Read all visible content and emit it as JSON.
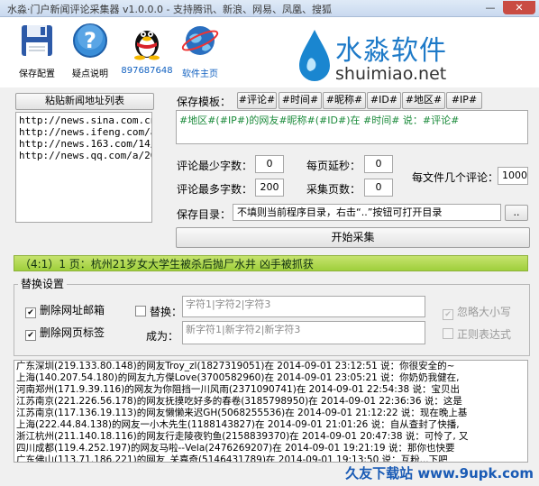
{
  "window": {
    "title": "水淼·门户新闻评论采集器 v1.0.0.0 - 支持腾讯、新浪、网易、凤凰、搜狐",
    "minimize": "—",
    "close": "✕"
  },
  "toolbar": {
    "save_config": "保存配置",
    "help": "疑点说明",
    "qq": "897687648",
    "homepage": "软件主页"
  },
  "logo": {
    "name": "水淼软件",
    "site": "shuimiao.net"
  },
  "url_list": {
    "button": "粘贴新闻地址列表",
    "lines": [
      "http://news.sina.com.cn/",
      "http://news.ifeng.com/a/",
      "http://news.163.com/14/0",
      "http://news.qq.com/a/201"
    ]
  },
  "template": {
    "label": "保存模板：",
    "tags": [
      "#评论#",
      "#时间#",
      "#昵称#",
      "#ID#",
      "#地区#",
      "#IP#"
    ],
    "value": "#地区#(#IP#)的网友#昵称#(#ID#)在 #时间# 说：#评论#"
  },
  "settings": {
    "min_chars_label": "评论最少字数：",
    "min_chars": "0",
    "max_chars_label": "评论最多字数：",
    "max_chars": "200",
    "delay_label": "每页延秒：",
    "delay": "0",
    "pages_label": "采集页数：",
    "pages": "0",
    "per_file_label": "每文件几个评论：",
    "per_file": "1000",
    "save_dir_label": "保存目录：",
    "save_dir_value": "不填则当前程序目录，右击“..”按钮可打开目录",
    "browse": "..",
    "start": "开始采集"
  },
  "status": "（4:1）1 页：杭州21岁女大学生被杀后抛尸水井 凶手被抓获",
  "replace": {
    "group_title": "替换设置",
    "del_email": "删除网址邮箱",
    "del_tags": "删除网页标签",
    "replace_label": "替换：",
    "to_label": "成为：",
    "replace_value": "字符1|字符2|字符3",
    "to_value": "新字符1|新字符2|新字符3",
    "ignore_case": "忽略大小写",
    "regex": "正则表达式"
  },
  "log_lines": [
    "广东深圳(219.133.80.148)的网友Troy_zl(1827319051)在 2014-09-01 23:12:51 说：你很安全的~",
    "上海(140.207.54.180)的网友九方傑Love(3700582960)在 2014-09-01 23:05:21 说：你奶奶我健在,",
    "河南郑州(171.9.39.116)的网友为你阻挡一川风雨(2371090741)在 2014-09-01 22:54:38 说：宝贝出",
    "江苏南京(221.226.56.178)的网友抚摸吃好多的春卷(3185798950)在 2014-09-01 22:36:36 说：这是",
    "江苏南京(117.136.19.113)的网友懒懒来迟GH(5068255536)在 2014-09-01 21:12:22 说：现在晚上基",
    "上海(222.44.84.138)的网友一小木先生(1188143827)在 2014-09-01 21:01:26 说：自从查封了快播,",
    "浙江杭州(211.140.18.116)的网友行走陵夜钓鱼(2158839370)在 2014-09-01 20:47:38 说：可怜了, 又",
    "四川成都(119.4.252.197)的网友马啦--Vela(2476269207)在 2014-09-01 19:21:19 说：那你也快要",
    "广东佛山(113.71.186.221)的网友_关嘉奇(5146431789)在 2014-09-01 19:13:50 说：互粉...下吧"
  ],
  "watermark": {
    "a": "久友下载站",
    "b": "www.9upk.com"
  }
}
